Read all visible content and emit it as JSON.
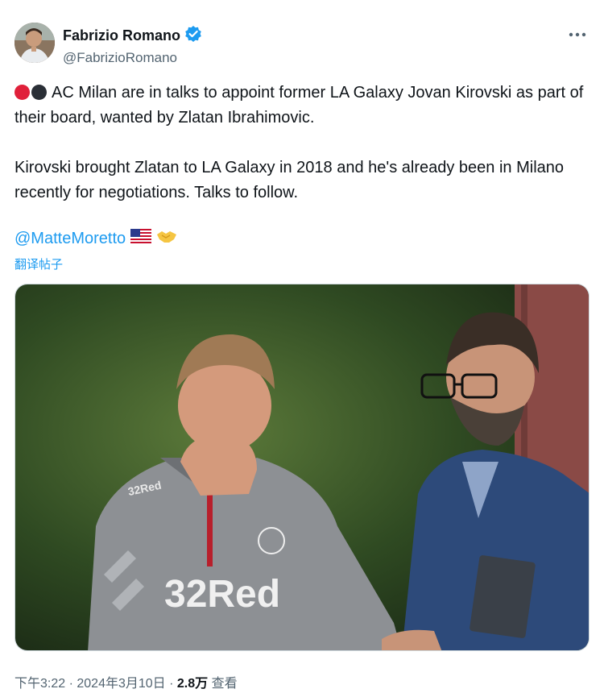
{
  "author": {
    "display_name": "Fabrizio Romano",
    "handle": "@FabrizioRomano",
    "verified_icon": "verified-badge-icon",
    "more_icon": "more-options-icon"
  },
  "tweet": {
    "paragraph1": "AC Milan are in talks to appoint former LA Galaxy Jovan Kirovski as part of their board, wanted by Zlatan Ibrahimovic.",
    "paragraph2": "Kirovski brought Zlatan to LA Galaxy in 2018 and he's already been in Milano recently for negotiations. Talks to follow.",
    "emoji_dots": [
      "red-circle",
      "black-circle"
    ],
    "mention": "@MatteMoretto",
    "mention_emojis": [
      "us-flag-icon",
      "handshake-icon"
    ],
    "translate_label": "翻译帖子"
  },
  "photo": {
    "shirt_text": "32Red",
    "sleeve_text": "32Red"
  },
  "meta": {
    "time": "下午3:22",
    "separator": " · ",
    "date": "2024年3月10日",
    "views_count": "2.8万",
    "views_label": " 查看"
  },
  "colors": {
    "link": "#1d9bf0",
    "verified": "#1d9bf0",
    "muted": "#536471",
    "text": "#0f1419",
    "red_dot": "#e0203a",
    "black_dot": "#2a2f36"
  }
}
